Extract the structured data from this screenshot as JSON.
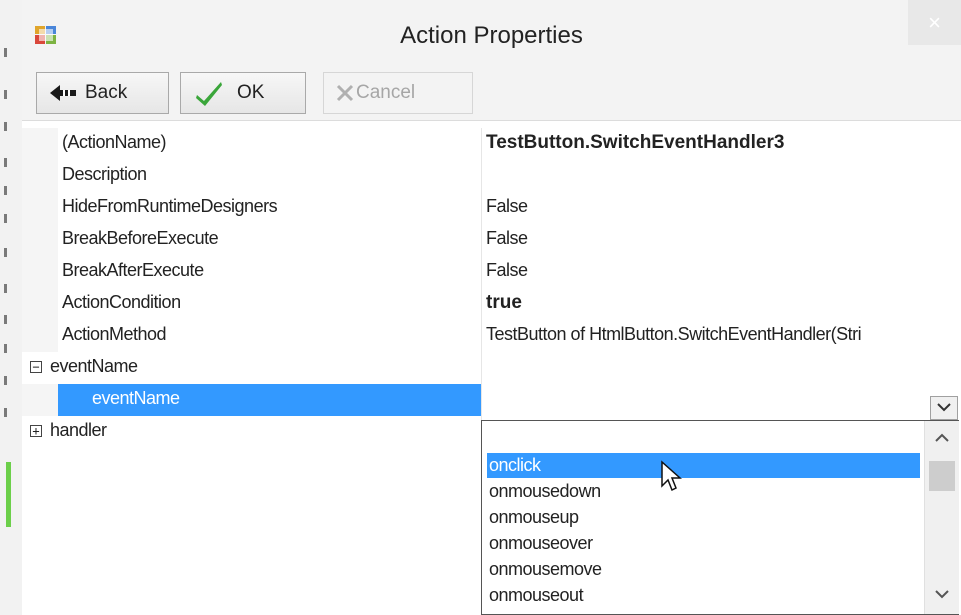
{
  "window": {
    "title": "Action Properties",
    "close_label": "×"
  },
  "toolbar": {
    "back_label": "Back",
    "ok_label": "OK",
    "cancel_label": "Cancel"
  },
  "properties": [
    {
      "name": "(ActionName)",
      "value": "TestButton.SwitchEventHandler3",
      "bold": true
    },
    {
      "name": "Description",
      "value": ""
    },
    {
      "name": "HideFromRuntimeDesigners",
      "value": "False"
    },
    {
      "name": "BreakBeforeExecute",
      "value": "False"
    },
    {
      "name": "BreakAfterExecute",
      "value": "False"
    },
    {
      "name": "ActionCondition",
      "value": "true",
      "bold": true
    },
    {
      "name": "ActionMethod",
      "value": "TestButton of HtmlButton.SwitchEventHandler(Stri"
    }
  ],
  "groups": {
    "eventname_group": {
      "name": "eventName",
      "expander": "−"
    },
    "eventname_child": {
      "name": "eventName"
    },
    "handler_group": {
      "name": "handler",
      "expander": "+"
    }
  },
  "dropdown": {
    "options": [
      "onclick",
      "onmousedown",
      "onmouseup",
      "onmouseover",
      "onmousemove",
      "onmouseout"
    ],
    "selected": "onclick"
  },
  "colors": {
    "selection": "#3399ff",
    "ok_check": "#3aa63a"
  }
}
